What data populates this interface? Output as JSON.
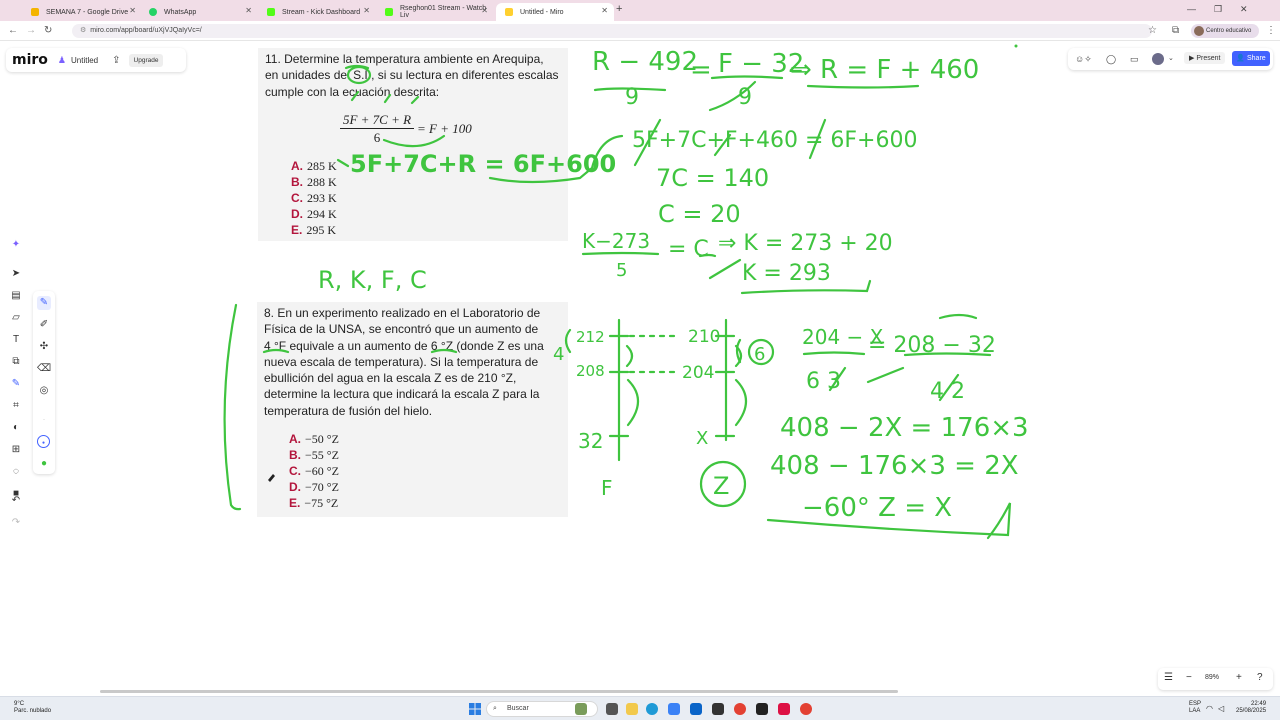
{
  "browser": {
    "tabs": [
      {
        "title": "SEMANA 7 - Google Drive",
        "active": false,
        "color": "#f4b400"
      },
      {
        "title": "WhatsApp",
        "active": false,
        "color": "#25d366"
      },
      {
        "title": "Stream - Kick Dashboard",
        "active": false,
        "color": "#53fc18"
      },
      {
        "title": "Rseghon01 Stream - Watch Liv",
        "active": false,
        "color": "#53fc18"
      },
      {
        "title": "Untitled - Miro",
        "active": true,
        "color": "#ffd02f"
      }
    ],
    "new_tab": "+",
    "url": "miro.com/app/board/uXjVJQaIyVc=/",
    "profile_label": "Centro educativo"
  },
  "miro": {
    "logo": "miro",
    "board_title": "Untitled",
    "upgrade_label": "Upgrade",
    "present_label": "Present",
    "share_label": "Share",
    "zoom_level": "89%"
  },
  "question11": {
    "text_lines": [
      "11. Determine la temperatura ambiente en Arequipa,",
      "en unidades del S.I., si su lectura en diferentes escalas",
      "cumple con la ecuación descrita:"
    ],
    "eq_numerator": "5F + 7C + R",
    "eq_denominator": "6",
    "eq_rhs": "= F + 100",
    "options": [
      {
        "letter": "A.",
        "value": "285 K"
      },
      {
        "letter": "B.",
        "value": "288 K"
      },
      {
        "letter": "C.",
        "value": "293 K"
      },
      {
        "letter": "D.",
        "value": "294 K"
      },
      {
        "letter": "E.",
        "value": "295 K"
      }
    ]
  },
  "question8": {
    "text_lines": [
      "8. En un experimento realizado en el Laboratorio de",
      "Física de la UNSA, se encontró que un aumento de",
      "4 °F equivale a un aumento de 6 °Z (donde Z es una",
      "nueva escala de temperatura). Si la temperatura de",
      "ebullición del agua en la escala Z es de 210 °Z,",
      "determine la lectura que indicará la escala Z para la",
      "temperatura de fusión del hielo."
    ],
    "options": [
      {
        "letter": "A.",
        "value": "−50 °Z"
      },
      {
        "letter": "B.",
        "value": "−55 °Z"
      },
      {
        "letter": "C.",
        "value": "−60 °Z"
      },
      {
        "letter": "D.",
        "value": "−70 °Z"
      },
      {
        "letter": "E.",
        "value": "−75 °Z"
      }
    ]
  },
  "handwriting": {
    "line1": "R − 492",
    "line1_den": "9",
    "line1_mid": "F − 32",
    "line1_rhs": "⇒ R = F + 460",
    "line2": "5F+7C+R = 6F+600",
    "line3": "5F+7C+F+460 = 6F+600",
    "line4": "7C = 140",
    "line5": "C = 20",
    "line6": "K−273",
    "line6_den": "5",
    "line6_mid": "= C",
    "line6_rhs": "⇒ K = 273 + 20",
    "line7": "K = 293",
    "rkfc": "R, K, F, C",
    "f_labels": [
      "212",
      "208",
      "32"
    ],
    "z_labels": [
      "210",
      "204",
      "X"
    ],
    "diff_left": "4",
    "diff_right": "6",
    "scale_f": "F",
    "scale_z": "Z",
    "eq_a": "204 − X",
    "eq_a_den": "6 3",
    "eq_b": "= 208 − 32",
    "eq_b_den": "4 2",
    "eq_c": "408 − 2X = 176×3",
    "eq_d": "408 − 176×3 = 2X",
    "eq_e": "−60° Z = X"
  },
  "ink_color": "#3fc43f",
  "taskbar": {
    "weather_temp": "9°C",
    "weather_desc": "Parc. nublado",
    "search_placeholder": "Buscar",
    "lang1": "ESP",
    "lang2": "LAA",
    "time": "22:49",
    "date": "25/08/2025"
  }
}
